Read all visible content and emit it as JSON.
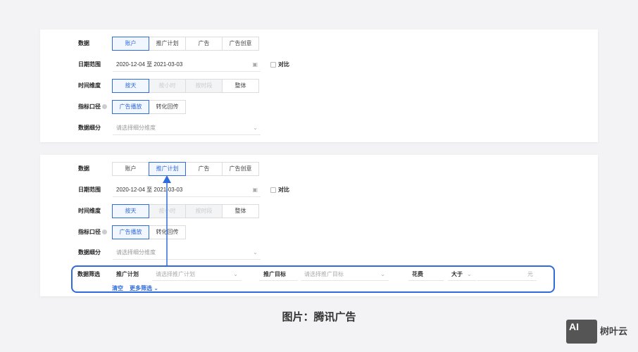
{
  "panel1": {
    "data_label": "数据",
    "data_tabs": [
      "账户",
      "推广计划",
      "广告",
      "广告创意"
    ],
    "date_label": "日期范围",
    "date_value": "2020-12-04 至 2021-03-03",
    "compare_label": "对比",
    "time_label": "时间维度",
    "time_tabs": [
      "按天",
      "按小时",
      "按时段",
      "整体"
    ],
    "metric_label": "指标口径",
    "metric_tabs": [
      "广告播放",
      "转化回传"
    ],
    "breakdown_label": "数据细分",
    "breakdown_placeholder": "请选择细分维度"
  },
  "panel2": {
    "data_label": "数据",
    "data_tabs": [
      "账户",
      "推广计划",
      "广告",
      "广告创意"
    ],
    "date_label": "日期范围",
    "date_value": "2020-12-04 至 2021-03-03",
    "compare_label": "对比",
    "time_label": "时间维度",
    "time_tabs": [
      "按天",
      "按小时",
      "按时段",
      "整体"
    ],
    "metric_label": "指标口径",
    "metric_tabs": [
      "广告播放",
      "转化回传"
    ],
    "breakdown_label": "数据细分",
    "breakdown_placeholder": "请选择细分维度",
    "filter": {
      "label": "数据筛选",
      "plan_label": "推广计划",
      "plan_placeholder": "请选择推广计划",
      "goal_label": "推广目标",
      "goal_placeholder": "请选择推广目标",
      "cost_label": "花费",
      "cost_op": "大于",
      "cost_unit": "元",
      "clear": "清空",
      "more": "更多筛选"
    }
  },
  "caption": "图片：腾讯广告",
  "watermark": {
    "logo": "AI",
    "brand": "树叶云"
  },
  "colors": {
    "accent": "#2f6bdc"
  }
}
